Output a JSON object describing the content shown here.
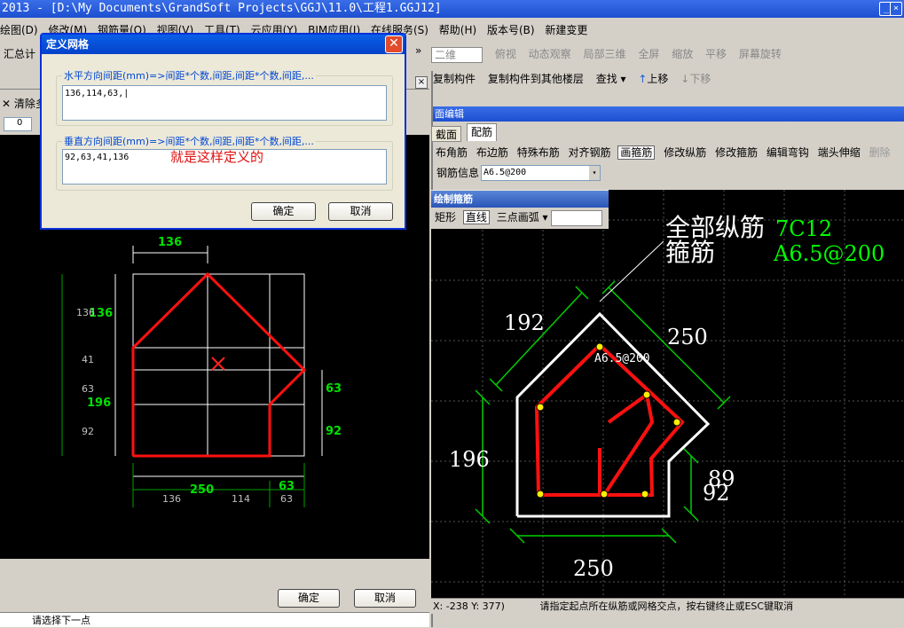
{
  "window": {
    "title": "2013 - [D:\\My Documents\\GrandSoft Projects\\GGJ\\11.0\\工程1.GGJ12]"
  },
  "menubar": {
    "items": [
      "绘图(D)",
      "修改(M)",
      "钢筋量(Q)",
      "视图(V)",
      "工具(T)",
      "云应用(Y)",
      "BIM应用(I)",
      "在线服务(S)",
      "帮助(H)",
      "版本号(B)",
      "新建变更"
    ]
  },
  "left": {
    "toolbar_label": "汇总计",
    "clear_label": "清除多",
    "spin_value": "0",
    "ok": "确定",
    "cancel": "取消",
    "status": "请选择下一点",
    "drawing": {
      "top_dim": "136",
      "bottom_dim": "250",
      "bottom_right_dim": "63",
      "left_dim1": "136",
      "left_dim2": "196",
      "right_dim1": "63",
      "right_dim2": "92",
      "bottom_cells": [
        "136",
        "114",
        "63"
      ],
      "left_cells": [
        "136",
        "41",
        "63",
        "92"
      ]
    }
  },
  "dialog": {
    "title": "定义网格",
    "h_label": "水平方向间距(mm)=>间距*个数,间距,间距*个数,间距,...",
    "h_value": "136,114,63,|",
    "v_label": "垂直方向间距(mm)=>间距*个数,间距,间距*个数,间距,...",
    "v_value": "92,63,41,136",
    "annotation": "就是这样定义的",
    "ok": "确定",
    "cancel": "取消"
  },
  "right": {
    "toolbar": [
      "二维",
      "俯视",
      "动态观察",
      "局部三维",
      "全屏",
      "缩放",
      "平移",
      "屏幕旋转"
    ],
    "toolbar3": [
      "复制构件",
      "复制构件到其他楼层",
      "查找",
      "上移",
      "下移"
    ],
    "section_title": "面编辑",
    "tabs": [
      "截面",
      "配筋"
    ],
    "tools": [
      "布角筋",
      "布边筋",
      "特殊布筋",
      "对齐钢筋",
      "画箍筋",
      "修改纵筋",
      "修改箍筋",
      "编辑弯钩",
      "端头伸缩",
      "删除"
    ],
    "rebar_label": "钢筋信息",
    "rebar_value": "A6.5@200",
    "draw_panel_title": "绘制箍筋",
    "draw_tools": [
      "矩形",
      "直线",
      "三点画弧"
    ],
    "drawing": {
      "label_long": "全部纵筋",
      "label_stirrup": "箍筋",
      "value_long": "7C12",
      "value_stirrup": "A6.5@200",
      "dim_192": "192",
      "dim_250_top": "250",
      "dim_196": "196",
      "dim_250_bottom": "250",
      "dim_89": "89",
      "dim_92": "92",
      "stirrup_tag": "A6.5@200"
    },
    "coords": "X: -238 Y: 377)",
    "status": "请指定起点所在纵筋或网格交点，按右键终止或ESC键取消"
  }
}
